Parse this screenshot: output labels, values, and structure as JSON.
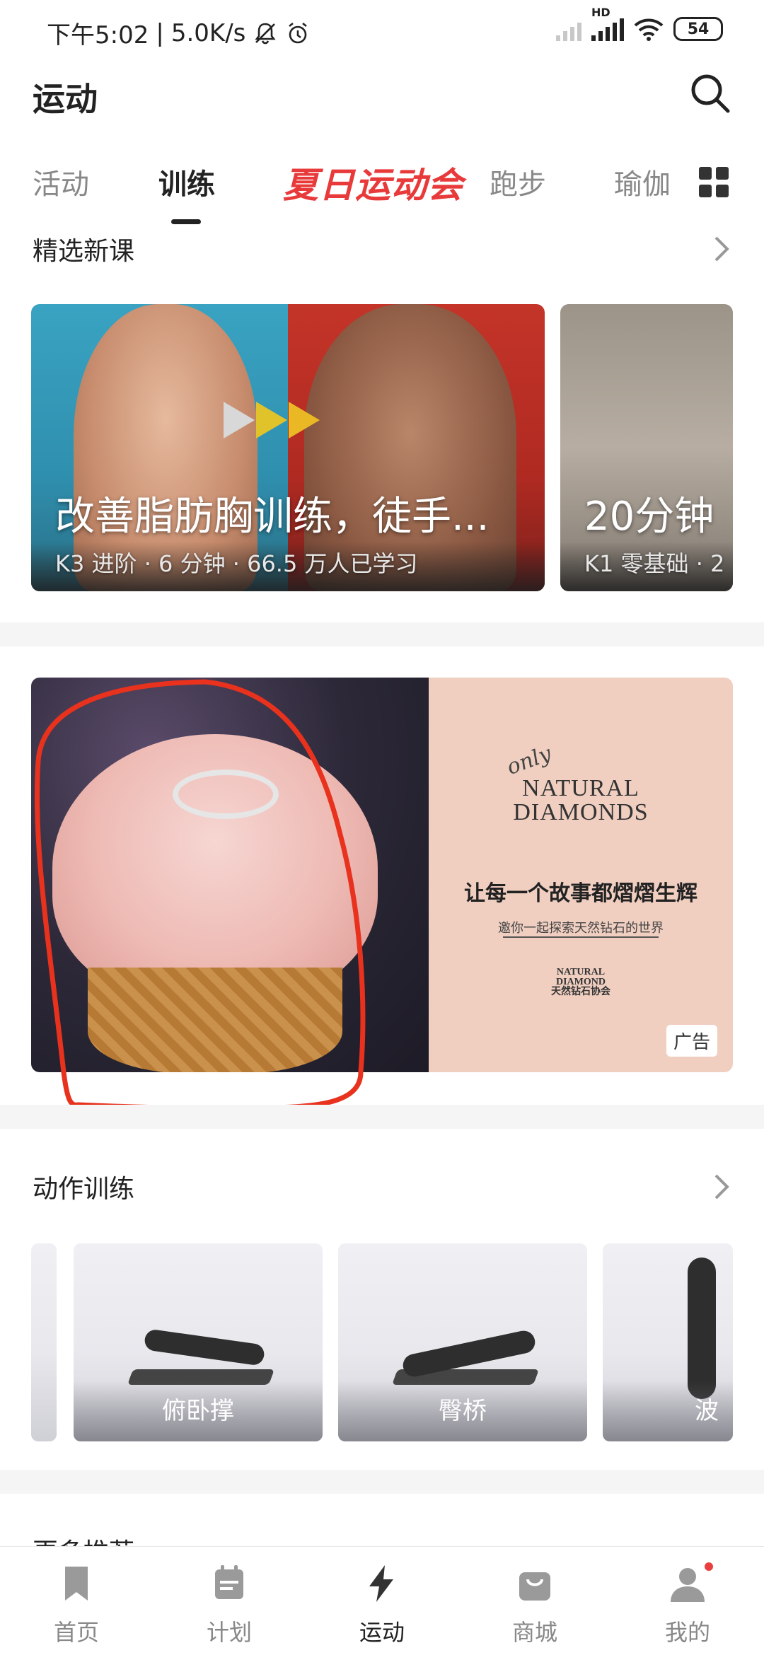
{
  "status_bar": {
    "time": "下午5:02",
    "net_speed": "5.0K/s",
    "hd_label": "HD",
    "battery": "54"
  },
  "header": {
    "title": "运动"
  },
  "tabs": {
    "items": [
      "活动",
      "训练",
      "夏日运动会",
      "跑步",
      "瑜伽"
    ],
    "active": "训练",
    "promo_color": "#e83a3a"
  },
  "featured": {
    "title": "精选新课",
    "courses": [
      {
        "title": "改善脂肪胸训练，徒手...",
        "meta": "K3 进阶 · 6 分钟 · 66.5 万人已学习"
      },
      {
        "title": "20分钟",
        "meta": "K1 零基础 · 2"
      }
    ]
  },
  "ad": {
    "only": "only",
    "brand_line1": "NATURAL",
    "brand_line2": "DIAMONDS",
    "slogan": "让每一个故事都熠熠生辉",
    "sub": "邀你一起探索天然钻石的世界",
    "logo_line1": "NATURAL",
    "logo_line2": "DIAMOND",
    "logo_line3": "天然钻石协会",
    "badge": "广告",
    "annotation_color": "#e8321e"
  },
  "actions": {
    "title": "动作训练",
    "items": [
      "俯卧撑",
      "臀桥",
      "波"
    ]
  },
  "peek": {
    "title": "更多推荐"
  },
  "bottom_nav": {
    "items": [
      "首页",
      "计划",
      "运动",
      "商城",
      "我的"
    ],
    "active": "运动"
  }
}
